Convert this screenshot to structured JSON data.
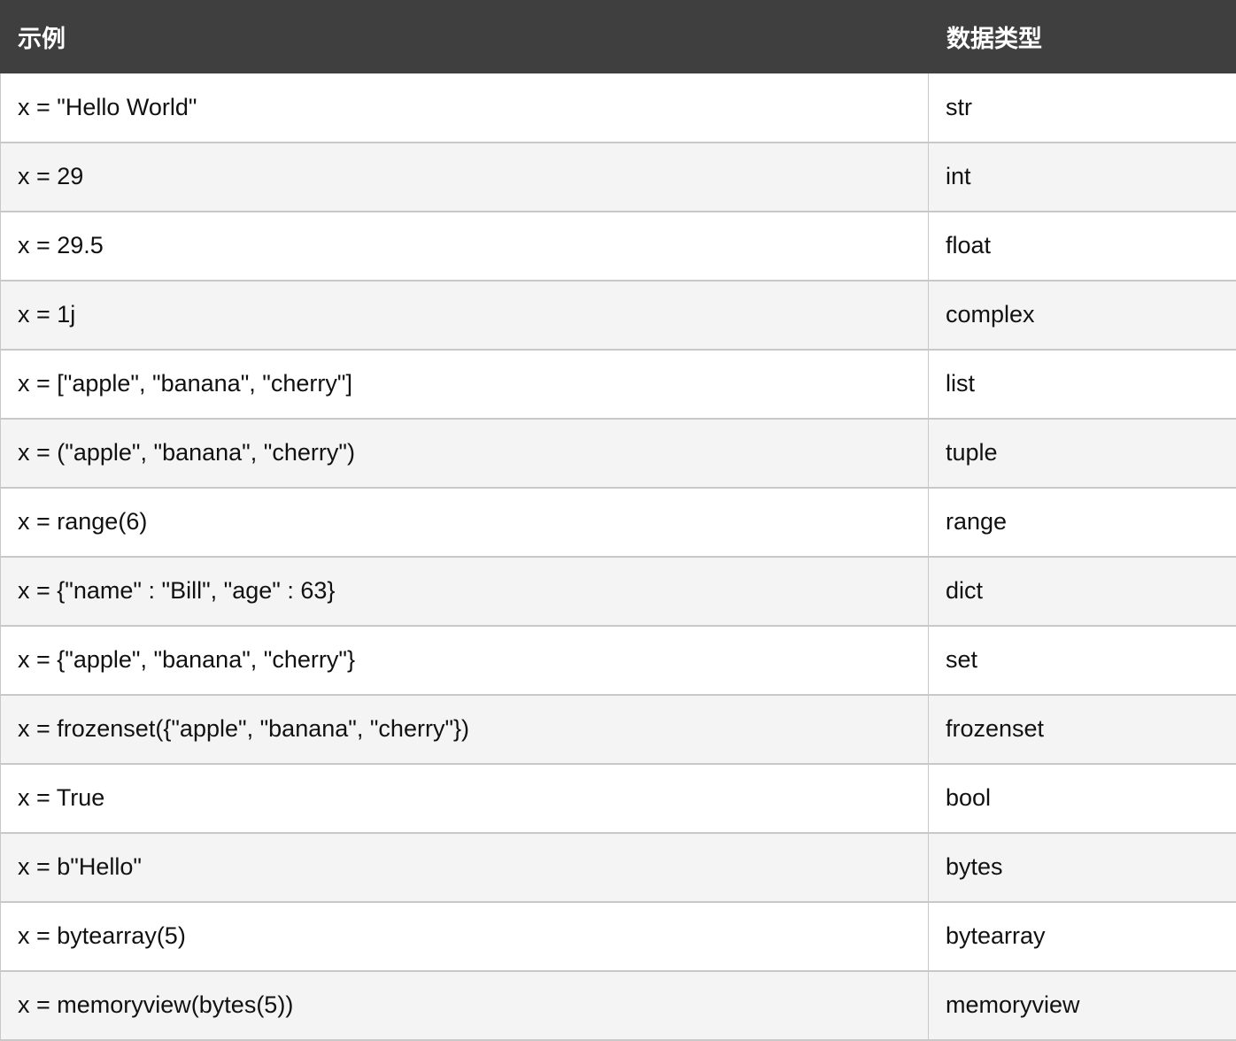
{
  "table": {
    "headers": [
      "示例",
      "数据类型"
    ],
    "rows": [
      {
        "example": "x = \"Hello World\"",
        "type": "str"
      },
      {
        "example": "x = 29",
        "type": "int"
      },
      {
        "example": "x = 29.5",
        "type": "float"
      },
      {
        "example": "x = 1j",
        "type": "complex"
      },
      {
        "example": "x = [\"apple\", \"banana\", \"cherry\"]",
        "type": "list"
      },
      {
        "example": "x = (\"apple\", \"banana\", \"cherry\")",
        "type": "tuple"
      },
      {
        "example": "x = range(6)",
        "type": "range"
      },
      {
        "example": "x = {\"name\" : \"Bill\", \"age\" : 63}",
        "type": "dict"
      },
      {
        "example": "x = {\"apple\", \"banana\", \"cherry\"}",
        "type": "set"
      },
      {
        "example": "x = frozenset({\"apple\", \"banana\", \"cherry\"})",
        "type": "frozenset"
      },
      {
        "example": "x = True",
        "type": "bool"
      },
      {
        "example": "x = b\"Hello\"",
        "type": "bytes"
      },
      {
        "example": "x = bytearray(5)",
        "type": "bytearray"
      },
      {
        "example": "x = memoryview(bytes(5))",
        "type": "memoryview"
      }
    ]
  }
}
